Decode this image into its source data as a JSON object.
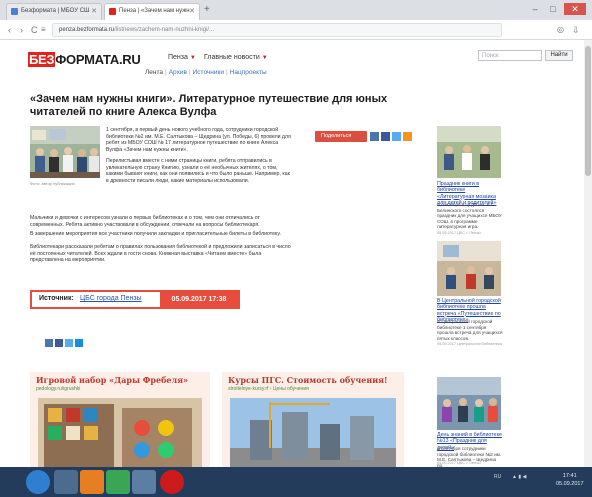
{
  "browser": {
    "tabs": [
      {
        "title": "Бeзформата | МБОУ СШ",
        "active": false,
        "color": "#4d7fd4"
      },
      {
        "title": "Пенза | «Зачем нам нужн",
        "active": true,
        "color": "#e0241b"
      }
    ],
    "url_domain": "penza.bezformata.ru",
    "url_path": "/listnews/zachem-nam-nuzhni-knigi/..."
  },
  "header": {
    "logo_a": "БЕЗ",
    "logo_b": "ФОРМАТА.RU",
    "city_label": "Пенза",
    "news_label": "Главные новости",
    "search_placeholder": "Поиск",
    "search_button": "Найти",
    "subnav": [
      "Лента",
      "Архив",
      "Источники",
      "Нацпроекты"
    ]
  },
  "article": {
    "title": "«Зачем нам нужны книги». Литературное путешествие для юных читателей по книге Алекса Вулфа",
    "photo_caption": "Фото: автор публикации",
    "p1": "1 сентября, в первый день нового учебного года, сотрудники городской библиотеки №2 им. М.Е. Салтыкова – Щедрина (ул. Победы, 6) провели для ребят из МБОУ СОШ № 17 литературное путешествие по книге Алекса Вулфа «Зачем нам нужны книги».",
    "p2": "Перелистывая вместе с ними страницы книги, ребята отправились в увлекательную страну Книгию, узнали о её необычных жителях, о том, какими бывают книги, как они появились и что было раньше. Например, как в древности писали люди, какие материалы использовали.",
    "p3": "Мальчики и девочки с интересом узнали о первых библиотеках и о том, чем они отличались от современных. Ребята активно участвовали в обсуждении, отвечали на вопросы библиотекаря.",
    "p4": "В завершение мероприятия все участники получили закладки и пригласительные билеты в библиотеку.",
    "p5": "Библиотекари рассказали ребятам о правилах пользования библиотекой и предложили записаться в число её постоянных читателей. Всех ждали в гости снова. Книжная выставка «Читаем вместе» была представлена на мероприятии.",
    "share_label": "Поделиться",
    "source_label": "Источник:",
    "source_value": "ЦБС города Пензы",
    "date": "05.09.2017  17:38"
  },
  "promos": [
    {
      "title": "Игровой набор «Дары Фребеля»",
      "link": "pedology.ru/igrushki"
    },
    {
      "title": "Курсы ПГС. Стоимость обучения!",
      "link": "stroitelnye-kursy.rf › Цены обучения"
    }
  ],
  "sidebar": [
    {
      "link": "Праздник книги в библиотеке «Литературная мозаика для детей и родителей»",
      "text": "1 сентября в ЦГДБ им. В.Г. Белинского состоялся праздник для учащихся МБОУ СОШ, в программе литературная игра.",
      "date": "05.09.2017  ЦБС г. Пензы"
    },
    {
      "link": "В Центральной городской библиотеке прошла встреча «Путешествие по библиотеке»",
      "text": "В Центральной городской библиотеке 1 сентября прошла встреча для учащихся пятых классов.",
      "date": "05.09.2017  Центральная библиотека"
    },
    {
      "link": "День знаний в библиотеке №13 «Праздник для детей»",
      "text": "1 сентября сотрудники городской библиотеки №2 им. М.Е. Салтыкова – Щедрина пр.",
      "date": "05.09.2017  ЦБС г. Пензы"
    }
  ],
  "taskbar": {
    "time": "17:41",
    "date": "05.09.2017"
  }
}
